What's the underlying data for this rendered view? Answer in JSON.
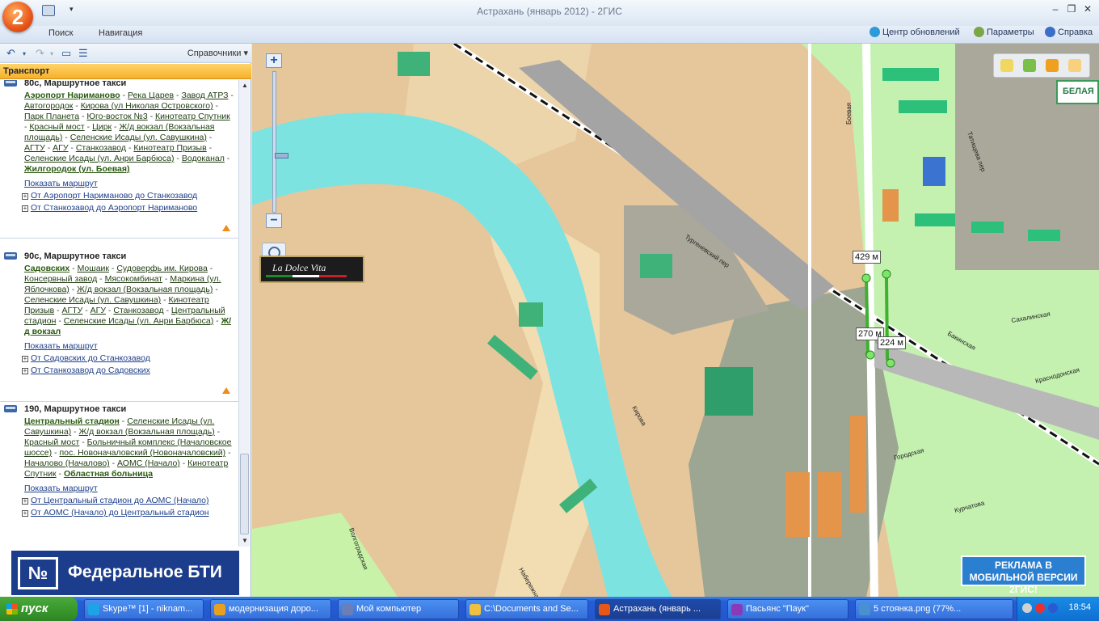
{
  "window": {
    "title": "Астрахань (январь 2012) - 2ГИС",
    "logo": "2"
  },
  "ribbon": {
    "tabs": [
      "Поиск",
      "Навигация"
    ],
    "update_center": "Центр обновлений",
    "params": "Параметры",
    "help": "Справка"
  },
  "sidebar": {
    "spravochniki": "Справочники",
    "header": "Транспорт",
    "routes": [
      {
        "title": "80с, Маршрутное такси",
        "stops": [
          "Аэропорт Нариманово",
          "Река Царев",
          "Завод АТРЗ",
          "Автогородок",
          "Кирова (ул Николая Островского)",
          "Парк Планета",
          "Юго-восток №3",
          "Кинотеатр Спутник",
          "Красный мост",
          "Цирк",
          "Ж/д вокзал (Вокзальная площадь)",
          "Селенские Исады (ул. Савушкина)",
          "АГТУ",
          "АГУ",
          "Станкозавод",
          "Кинотеатр Призыв",
          "Селенские Исады (ул. Анри Барбюса)",
          "Водоканал",
          "Жилгородок (ул. Боевая)"
        ],
        "show": "Показать маршрут",
        "dir1": "От Аэропорт Нариманово до Станкозавод",
        "dir2": "От Станкозавод до Аэропорт Нариманово"
      },
      {
        "title": "90с, Маршрутное такси",
        "stops": [
          "Садовских",
          "Мошаик",
          "Судоверфь им. Кирова",
          "Консервный завод",
          "Мясокомбинат",
          "Маркина (ул. Яблочкова)",
          "Ж/д вокзал (Вокзальная площадь)",
          "Селенские Исады (ул. Савушкина)",
          "Кинотеатр Призыв",
          "АГТУ",
          "АГУ",
          "Станкозавод",
          "Центральный стадион",
          "Селенские Исады (ул. Анри Барбюса)",
          "Ж/д вокзал"
        ],
        "show": "Показать маршрут",
        "dir1": "От Садовских до Станкозавод",
        "dir2": "От Станкозавод до Садовских"
      },
      {
        "title": "190, Маршрутное такси",
        "stops": [
          "Центральный стадион",
          "Селенские Исады (ул. Савушкина)",
          "Ж/д вокзал (Вокзальная площадь)",
          "Красный мост",
          "Больничный комплекс (Началовское шоссе)",
          "пос. Новоначаловский (Новоначаловский)",
          "Началово (Началово)",
          "АОМС (Начало)",
          "Кинотеатр Спутник",
          "Областная больница"
        ],
        "show": "Показать маршрут",
        "dir1": "От Центральный стадион до АОМС (Начало)",
        "dir2": "От АОМС (Начало) до Центральный стадион"
      }
    ],
    "ad_logo": "№",
    "ad_text": "Федеральное БТИ"
  },
  "map": {
    "dolce_vita": "La Dolce Vita",
    "distances": [
      "429 м",
      "270 м",
      "224 м"
    ],
    "brand_corner": "БЕЛАЯ",
    "mobile_ad": "РЕКЛАМА В МОБИЛЬНОЙ ВЕРСИИ 2ГИС!",
    "street_labels": [
      "Боевая",
      "Татищева пер",
      "Сахалинская",
      "Городская",
      "Кирова",
      "Курчатова",
      "Бакинская",
      "Краснодонская",
      "Тургеневский пер",
      "Волгоградская",
      "Набережная"
    ],
    "colors": {
      "river": "#7de3e0",
      "road": "#e8c27f",
      "block": "#d7a872",
      "park": "#c4f0b0",
      "building": "#3fb27a",
      "industrial": "#a9a89a"
    }
  },
  "taskbar": {
    "start": "пуск",
    "tasks": [
      {
        "label": "Skype™ [1] - niknam...",
        "color": "#1fa3e8"
      },
      {
        "label": "модернизация доро...",
        "color": "#e8a020"
      },
      {
        "label": "Мой компьютер",
        "color": "#6a7fb8"
      },
      {
        "label": "C:\\Documents and Se...",
        "color": "#f0c040"
      },
      {
        "label": "Астрахань (январь ...",
        "color": "#e8561a"
      },
      {
        "label": "Пасьянс \"Паук\"",
        "color": "#8a3ab8"
      },
      {
        "label": "5 стоянка.png (77%...",
        "color": "#4a90d0"
      }
    ],
    "clock": "18:54"
  }
}
